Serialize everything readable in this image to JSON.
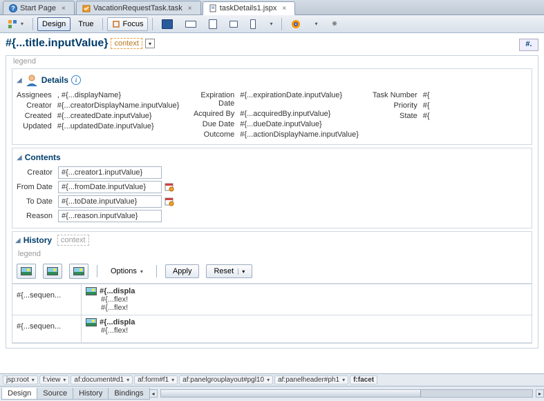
{
  "tabs": [
    {
      "label": "Start Page",
      "icon": "help"
    },
    {
      "label": "VacationRequestTask.task",
      "icon": "task"
    },
    {
      "label": "taskDetails1.jspx",
      "icon": "page"
    }
  ],
  "toolbar": {
    "design": "Design",
    "true_label": "True",
    "focus": "Focus"
  },
  "title": {
    "expr": "#{...title.inputValue}",
    "context": "context",
    "hash": "#."
  },
  "legend": "legend",
  "details": {
    "title": "Details",
    "col1": [
      {
        "label": "Assignees",
        "value": ", #{...displayName}"
      },
      {
        "label": "Creator",
        "value": "#{...creatorDisplayName.inputValue}"
      },
      {
        "label": "Created",
        "value": "#{...createdDate.inputValue}"
      },
      {
        "label": "Updated",
        "value": "#{...updatedDate.inputValue}"
      }
    ],
    "col2": [
      {
        "label": "Expiration Date",
        "value": "#{...expirationDate.inputValue}"
      },
      {
        "label": "Acquired By",
        "value": "#{...acquiredBy.inputValue}"
      },
      {
        "label": "Due Date",
        "value": "#{...dueDate.inputValue}"
      },
      {
        "label": "Outcome",
        "value": "#{...actionDisplayName.inputValue}"
      }
    ],
    "col3": [
      {
        "label": "Task Number",
        "value": "#{"
      },
      {
        "label": "Priority",
        "value": "#{"
      },
      {
        "label": "State",
        "value": "#{"
      }
    ]
  },
  "contents": {
    "title": "Contents",
    "fields": [
      {
        "label": "Creator",
        "value": "#{...creator1.inputValue}",
        "date": false
      },
      {
        "label": "From Date",
        "value": "#{...fromDate.inputValue}",
        "date": true
      },
      {
        "label": "To Date",
        "value": "#{...toDate.inputValue}",
        "date": true
      },
      {
        "label": "Reason",
        "value": "#{...reason.inputValue}",
        "date": false
      }
    ]
  },
  "history": {
    "title": "History",
    "context": "context",
    "legend": "legend",
    "options": "Options",
    "apply": "Apply",
    "reset": "Reset",
    "rows": [
      {
        "left": "#{...sequen...",
        "displa": "#{...displa",
        "flex1": "#{...flex!",
        "flex2": "#{...flex!"
      },
      {
        "left": "#{...sequen...",
        "displa": "#{...displa",
        "flex1": "#{...flex!",
        "flex2": ""
      }
    ]
  },
  "breadcrumb": [
    "jsp:root",
    "f:view",
    "af:document#d1",
    "af:form#f1",
    "af:panelgrouplayout#pgl10",
    "af:panelheader#ph1",
    "f:facet"
  ],
  "bottom_tabs": [
    "Design",
    "Source",
    "History",
    "Bindings"
  ]
}
